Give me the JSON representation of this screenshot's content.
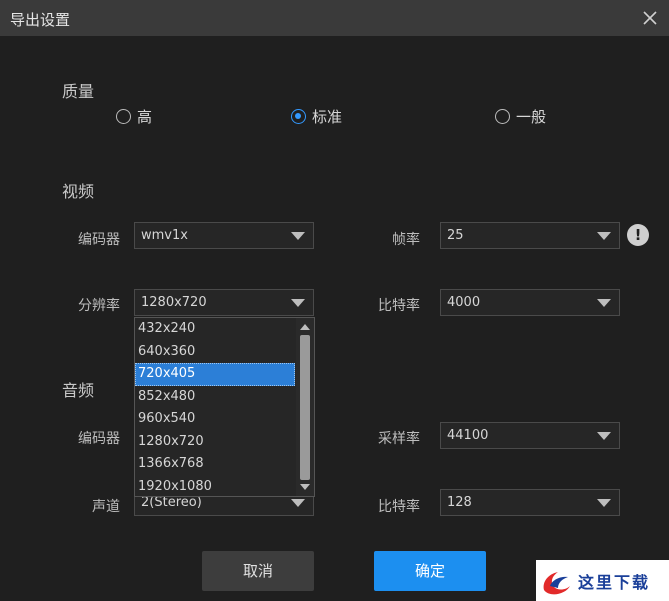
{
  "dialog": {
    "title": "导出设置",
    "close_icon": "close-icon"
  },
  "quality": {
    "label": "质量",
    "options": [
      {
        "label": "高",
        "checked": false
      },
      {
        "label": "标准",
        "checked": true
      },
      {
        "label": "一般",
        "checked": false
      }
    ]
  },
  "video": {
    "label": "视频",
    "encoder_label": "编码器",
    "encoder_value": "wmv1x",
    "framerate_label": "帧率",
    "framerate_value": "25",
    "resolution_label": "分辨率",
    "resolution_value": "1280x720",
    "bitrate_label": "比特率",
    "bitrate_value": "4000",
    "resolution_options": [
      "432x240",
      "640x360",
      "720x405",
      "852x480",
      "960x540",
      "1280x720",
      "1366x768",
      "1920x1080"
    ],
    "highlighted_option": "720x405",
    "info_icon": "exclamation-icon"
  },
  "audio": {
    "label": "音频",
    "encoder_label": "编码器",
    "samplerate_label": "采样率",
    "samplerate_value": "44100",
    "channel_label": "声道",
    "channel_value": "2(Stereo)",
    "bitrate_label": "比特率",
    "bitrate_value": "128"
  },
  "buttons": {
    "cancel": "取消",
    "ok": "确定"
  },
  "watermark": {
    "text": "这里下载"
  },
  "colors": {
    "accent": "#1c8ff0",
    "background": "#1f1f1f",
    "titlebar": "#3a3a3a"
  }
}
